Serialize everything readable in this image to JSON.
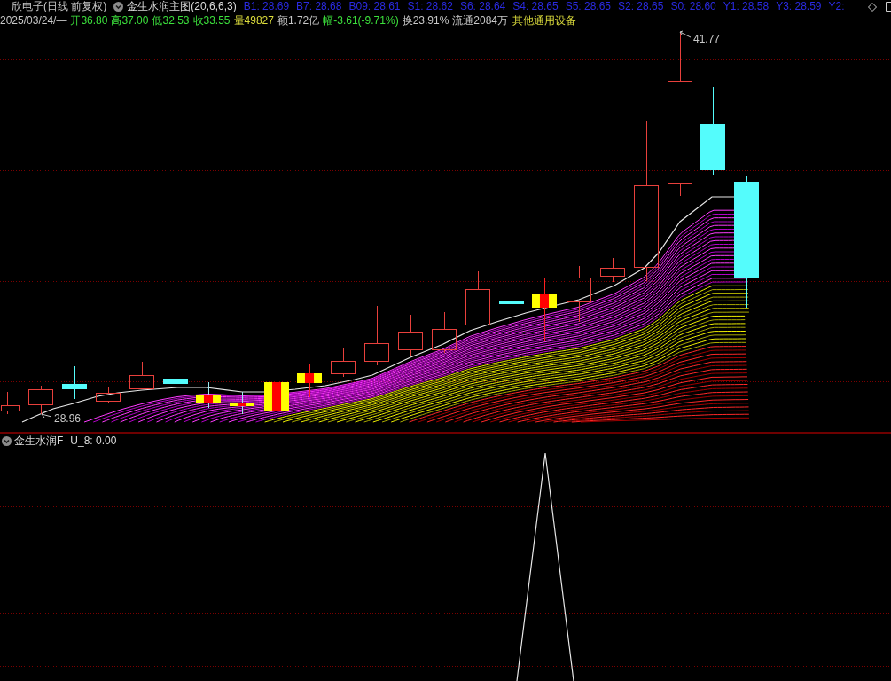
{
  "main_header": {
    "security": "欣电子(日线 前复权)",
    "indicator": "金生水润主图(20,6,6,3)",
    "values": [
      "B1: 28.69",
      "B7: 28.68",
      "B09: 28.61",
      "S1: 28.62",
      "S6: 28.64",
      "S4: 28.65",
      "S5: 28.65",
      "S2: 28.65",
      "S0: 28.60",
      "Y1: 28.58",
      "Y3: 28.59",
      "Y2:"
    ]
  },
  "quote": {
    "date": "2025/03/24/—",
    "fields": [
      {
        "text": "开36.80",
        "color": "#3ce03c"
      },
      {
        "text": "高37.00",
        "color": "#3ce03c"
      },
      {
        "text": "低32.53",
        "color": "#3ce03c"
      },
      {
        "text": "收33.55",
        "color": "#3ce03c"
      },
      {
        "text": "量49827",
        "color": "#dcdc3c"
      },
      {
        "text": "额1.72亿",
        "color": "#c8c8c8"
      },
      {
        "text": "幅-3.61(-9.71%)",
        "color": "#3ce03c"
      },
      {
        "text": "换23.91%",
        "color": "#c8c8c8"
      },
      {
        "text": "流通2084万",
        "color": "#c8c8c8"
      }
    ],
    "industry": "其他通用设备"
  },
  "price_chart": {
    "high_label": "41.77",
    "low_label": "28.96"
  },
  "indicator_panel": {
    "title": "金生水润F",
    "values": [
      "U_8: 0.00"
    ]
  }
}
